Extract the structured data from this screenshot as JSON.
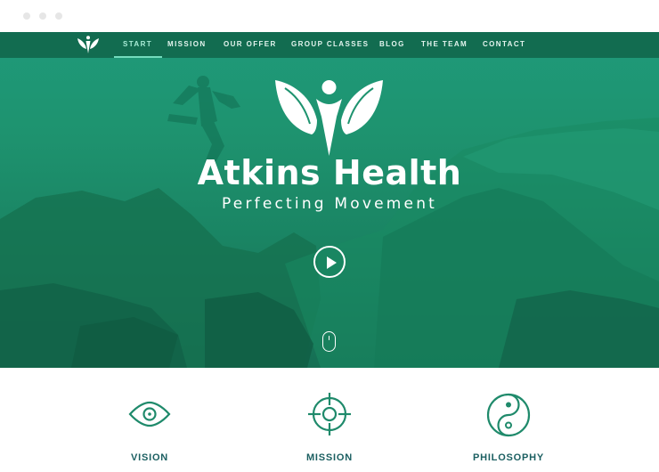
{
  "browser": {
    "dots": [
      "#e6e6e6",
      "#e6e6e6",
      "#e6e6e6"
    ]
  },
  "nav": {
    "items": [
      {
        "label": "START",
        "active": true
      },
      {
        "label": "MISSION"
      },
      {
        "label": "OUR OFFER"
      },
      {
        "label": "GROUP CLASSES"
      },
      {
        "label": "BLOG"
      },
      {
        "label": "THE TEAM"
      },
      {
        "label": "CONTACT"
      }
    ]
  },
  "hero": {
    "title": "Atkins Health",
    "tagline": "Perfecting Movement",
    "play_icon": "play-icon",
    "scroll_icon": "mouse-scroll-icon"
  },
  "features": [
    {
      "label": "VISION",
      "icon": "eye-icon"
    },
    {
      "label": "MISSION",
      "icon": "target-icon"
    },
    {
      "label": "PHILOSOPHY",
      "icon": "yin-yang-icon"
    }
  ],
  "colors": {
    "hero_green": "#1e936f",
    "nav_green": "#11684d",
    "accent_mint": "#74dbbd",
    "feature_teal": "#1b5f61",
    "icon_green": "#1f8a6b"
  }
}
